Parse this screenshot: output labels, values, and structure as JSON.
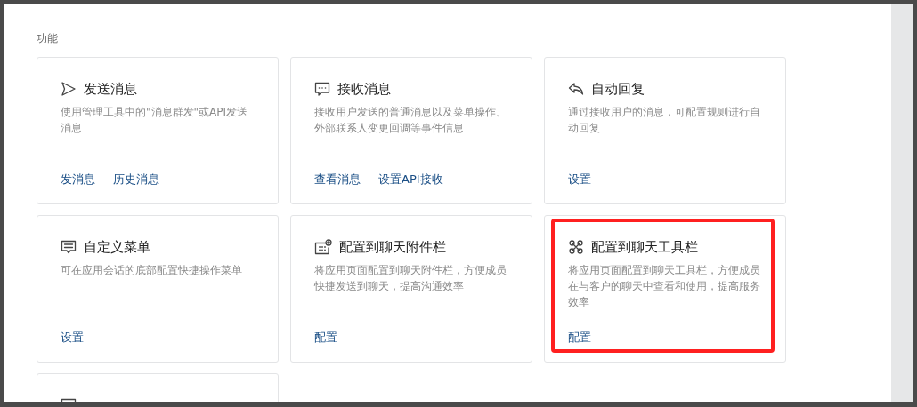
{
  "section": {
    "title": "功能"
  },
  "cards": [
    {
      "kind": "send",
      "title": "发送消息",
      "description": "使用管理工具中的\"消息群发\"或API发送消息",
      "links": [
        "发消息",
        "历史消息"
      ],
      "highlighted": false
    },
    {
      "kind": "chat",
      "title": "接收消息",
      "description": "接收用户发送的普通消息以及菜单操作、外部联系人变更回调等事件信息",
      "links": [
        "查看消息",
        "设置API接收"
      ],
      "highlighted": false
    },
    {
      "kind": "reply",
      "title": "自动回复",
      "description": "通过接收用户的消息，可配置规则进行自动回复",
      "links": [
        "设置"
      ],
      "highlighted": false
    },
    {
      "kind": "menu",
      "title": "自定义菜单",
      "description": "可在应用会话的底部配置快捷操作菜单",
      "links": [
        "设置"
      ],
      "highlighted": false
    },
    {
      "kind": "attach",
      "title": "配置到聊天附件栏",
      "description": "将应用页面配置到聊天附件栏，方便成员快捷发送到聊天，提高沟通效率",
      "links": [
        "配置"
      ],
      "highlighted": false
    },
    {
      "kind": "toolbar",
      "title": "配置到聊天工具栏",
      "description": "将应用页面配置到聊天工具栏，方便成员在与客户的聊天中查看和使用，提高服务效率",
      "links": [
        "配置"
      ],
      "highlighted": true
    },
    {
      "kind": "menu",
      "highlighted": false
    }
  ]
}
